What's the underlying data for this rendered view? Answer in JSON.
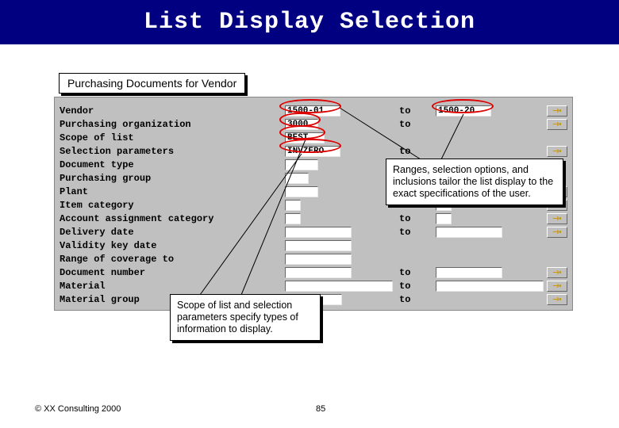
{
  "title": "List Display Selection",
  "window_title": "Purchasing Documents for Vendor",
  "to_label": "to",
  "rows": [
    {
      "label": "Vendor",
      "val1": "1500-01",
      "to": true,
      "val2": "1500-20",
      "btn": true,
      "w1": 70,
      "w2": 70
    },
    {
      "label": "Purchasing organization",
      "val1": "3000",
      "to": true,
      "val2": "",
      "btn": true,
      "w1": 42,
      "w2": 0
    },
    {
      "label": "Scope of list",
      "val1": "BEST",
      "to": false,
      "val2": "",
      "btn": false,
      "w1": 50,
      "w2": 0
    },
    {
      "label": "Selection parameters",
      "val1": "INVZERO",
      "to": true,
      "val2": "",
      "btn": true,
      "w1": 70,
      "w2": 0
    },
    {
      "label": "Document type",
      "val1": "",
      "to": false,
      "val2": "",
      "btn": false,
      "w1": 42,
      "w2": 0
    },
    {
      "label": "Purchasing group",
      "val1": "",
      "to": false,
      "val2": "",
      "btn": false,
      "w1": 30,
      "w2": 0
    },
    {
      "label": "Plant",
      "val1": "",
      "to": true,
      "val2": "",
      "btn": true,
      "w1": 42,
      "w2": 42
    },
    {
      "label": "Item category",
      "val1": "",
      "to": true,
      "val2": "",
      "btn": true,
      "w1": 20,
      "w2": 20
    },
    {
      "label": "Account assignment category",
      "val1": "",
      "to": true,
      "val2": "",
      "btn": true,
      "w1": 20,
      "w2": 20
    },
    {
      "label": "Delivery date",
      "val1": "",
      "to": true,
      "val2": "",
      "btn": true,
      "w1": 84,
      "w2": 84
    },
    {
      "label": "Validity key date",
      "val1": "",
      "to": false,
      "val2": "",
      "btn": false,
      "w1": 84,
      "w2": 0
    },
    {
      "label": "Range of coverage to",
      "val1": "",
      "to": false,
      "val2": "",
      "btn": false,
      "w1": 84,
      "w2": 0
    },
    {
      "label": "Document number",
      "val1": "",
      "to": true,
      "val2": "",
      "btn": true,
      "w1": 84,
      "w2": 84
    },
    {
      "label": "Material",
      "val1": "",
      "to": true,
      "val2": "",
      "btn": true,
      "w1": 136,
      "w2": 136
    },
    {
      "label": "Material group",
      "val1": "",
      "to": true,
      "val2": "",
      "btn": true,
      "w1": 72,
      "w2": 0
    }
  ],
  "callouts": {
    "ranges": "Ranges, selection options, and inclusions tailor the list display to the exact specifications of the user.",
    "scope": "Scope of list and selection parameters specify types of information to display."
  },
  "footer": {
    "copyright": "© XX Consulting 2000",
    "page": "85"
  }
}
